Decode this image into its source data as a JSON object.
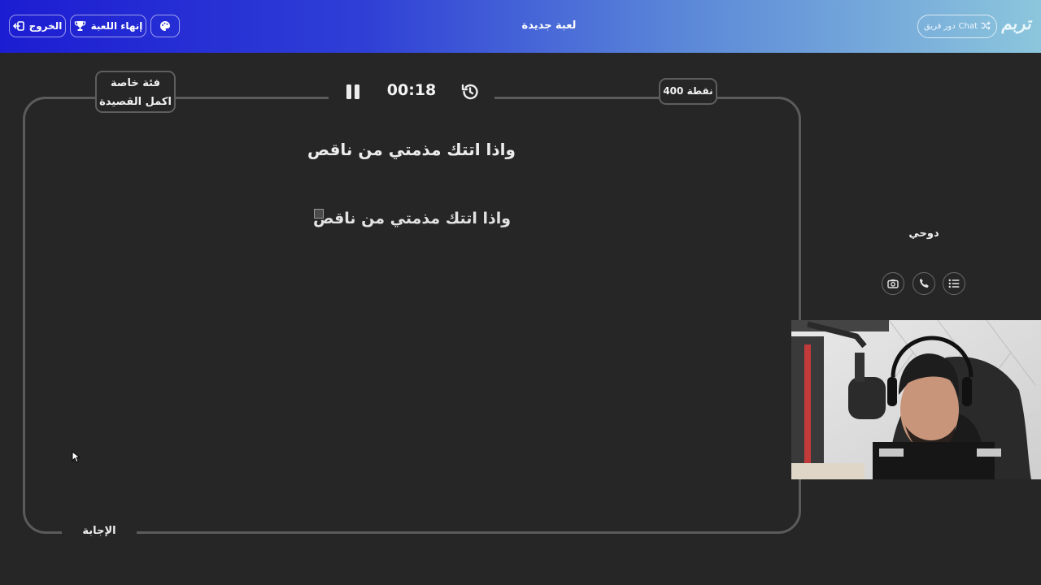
{
  "header": {
    "exit_label": "الخروج",
    "end_game_label": "إنهاء اللعبة",
    "title": "لعبة جديدة",
    "team_turn_label": "دور فريق",
    "team_name": "Chat",
    "logo_text": "تربم"
  },
  "board": {
    "category_type": "فئة خاصة",
    "category_name": "اكمل القصيدة",
    "timer": "00:18",
    "points": "400 نقطة",
    "question": "واذا اتتك مذمتي من ناقص",
    "image_alt": "واذا اتتك مذمتي من ناقص",
    "answer_label": "الإجابة"
  },
  "side": {
    "player_name": "دوحي"
  },
  "icons": {
    "exit": "exit-icon",
    "trophy": "trophy-icon",
    "palette": "palette-icon",
    "shuffle": "shuffle-icon",
    "pause": "pause-icon",
    "history": "history-icon",
    "camera": "camera-switch-icon",
    "phone": "phone-icon",
    "list": "list-icon"
  },
  "colors": {
    "header_gradient_start": "#1c1dd2",
    "header_gradient_end": "#8cc6dc",
    "background": "#262626",
    "board_border": "#5b5b5b"
  }
}
